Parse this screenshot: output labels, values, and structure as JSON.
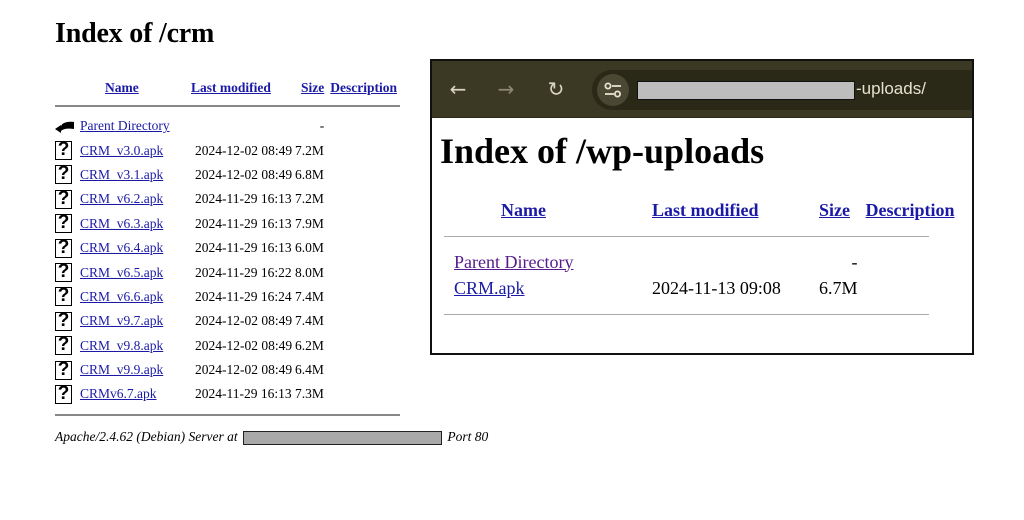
{
  "left_listing": {
    "title": "Index of /crm",
    "columns": {
      "name": "Name",
      "last_modified": "Last modified",
      "size": "Size",
      "description": "Description"
    },
    "parent": {
      "icon": "back-arrow-icon",
      "label": "Parent Directory",
      "size": "-"
    },
    "files": [
      {
        "icon": "unknown-file-icon",
        "name": "CRM_v3.0.apk",
        "modified": "2024-12-02 08:49",
        "size": "7.2M"
      },
      {
        "icon": "unknown-file-icon",
        "name": "CRM_v3.1.apk",
        "modified": "2024-12-02 08:49",
        "size": "6.8M"
      },
      {
        "icon": "unknown-file-icon",
        "name": "CRM_v6.2.apk",
        "modified": "2024-11-29 16:13",
        "size": "7.2M"
      },
      {
        "icon": "unknown-file-icon",
        "name": "CRM_v6.3.apk",
        "modified": "2024-11-29 16:13",
        "size": "7.9M"
      },
      {
        "icon": "unknown-file-icon",
        "name": "CRM_v6.4.apk",
        "modified": "2024-11-29 16:13",
        "size": "6.0M"
      },
      {
        "icon": "unknown-file-icon",
        "name": "CRM_v6.5.apk",
        "modified": "2024-11-29 16:22",
        "size": "8.0M"
      },
      {
        "icon": "unknown-file-icon",
        "name": "CRM_v6.6.apk",
        "modified": "2024-11-29 16:24",
        "size": "7.4M"
      },
      {
        "icon": "unknown-file-icon",
        "name": "CRM_v9.7.apk",
        "modified": "2024-12-02 08:49",
        "size": "7.4M"
      },
      {
        "icon": "unknown-file-icon",
        "name": "CRM_v9.8.apk",
        "modified": "2024-12-02 08:49",
        "size": "6.2M"
      },
      {
        "icon": "unknown-file-icon",
        "name": "CRM_v9.9.apk",
        "modified": "2024-12-02 08:49",
        "size": "6.4M"
      },
      {
        "icon": "unknown-file-icon",
        "name": "CRMv6.7.apk",
        "modified": "2024-11-29 16:13",
        "size": "7.3M"
      }
    ],
    "footer": {
      "prefix": "Apache/2.4.62 (Debian) Server at",
      "suffix": "Port 80"
    }
  },
  "browser": {
    "toolbar": {
      "back_icon": "←",
      "forward_icon": "→",
      "reload_icon": "↻",
      "url_tail": "-uploads/"
    },
    "colors": {
      "toolbar_bg": "#3b3823",
      "link": "#1a1aa6",
      "visited_link": "#551a8b"
    },
    "page": {
      "title": "Index of /wp-uploads",
      "columns": {
        "name": "Name",
        "last_modified": "Last modified",
        "size": "Size",
        "description": "Description"
      },
      "parent": {
        "label": "Parent Directory",
        "size": "-"
      },
      "files": [
        {
          "name": "CRM.apk",
          "modified": "2024-11-13 09:08",
          "size": "6.7M"
        }
      ]
    }
  }
}
